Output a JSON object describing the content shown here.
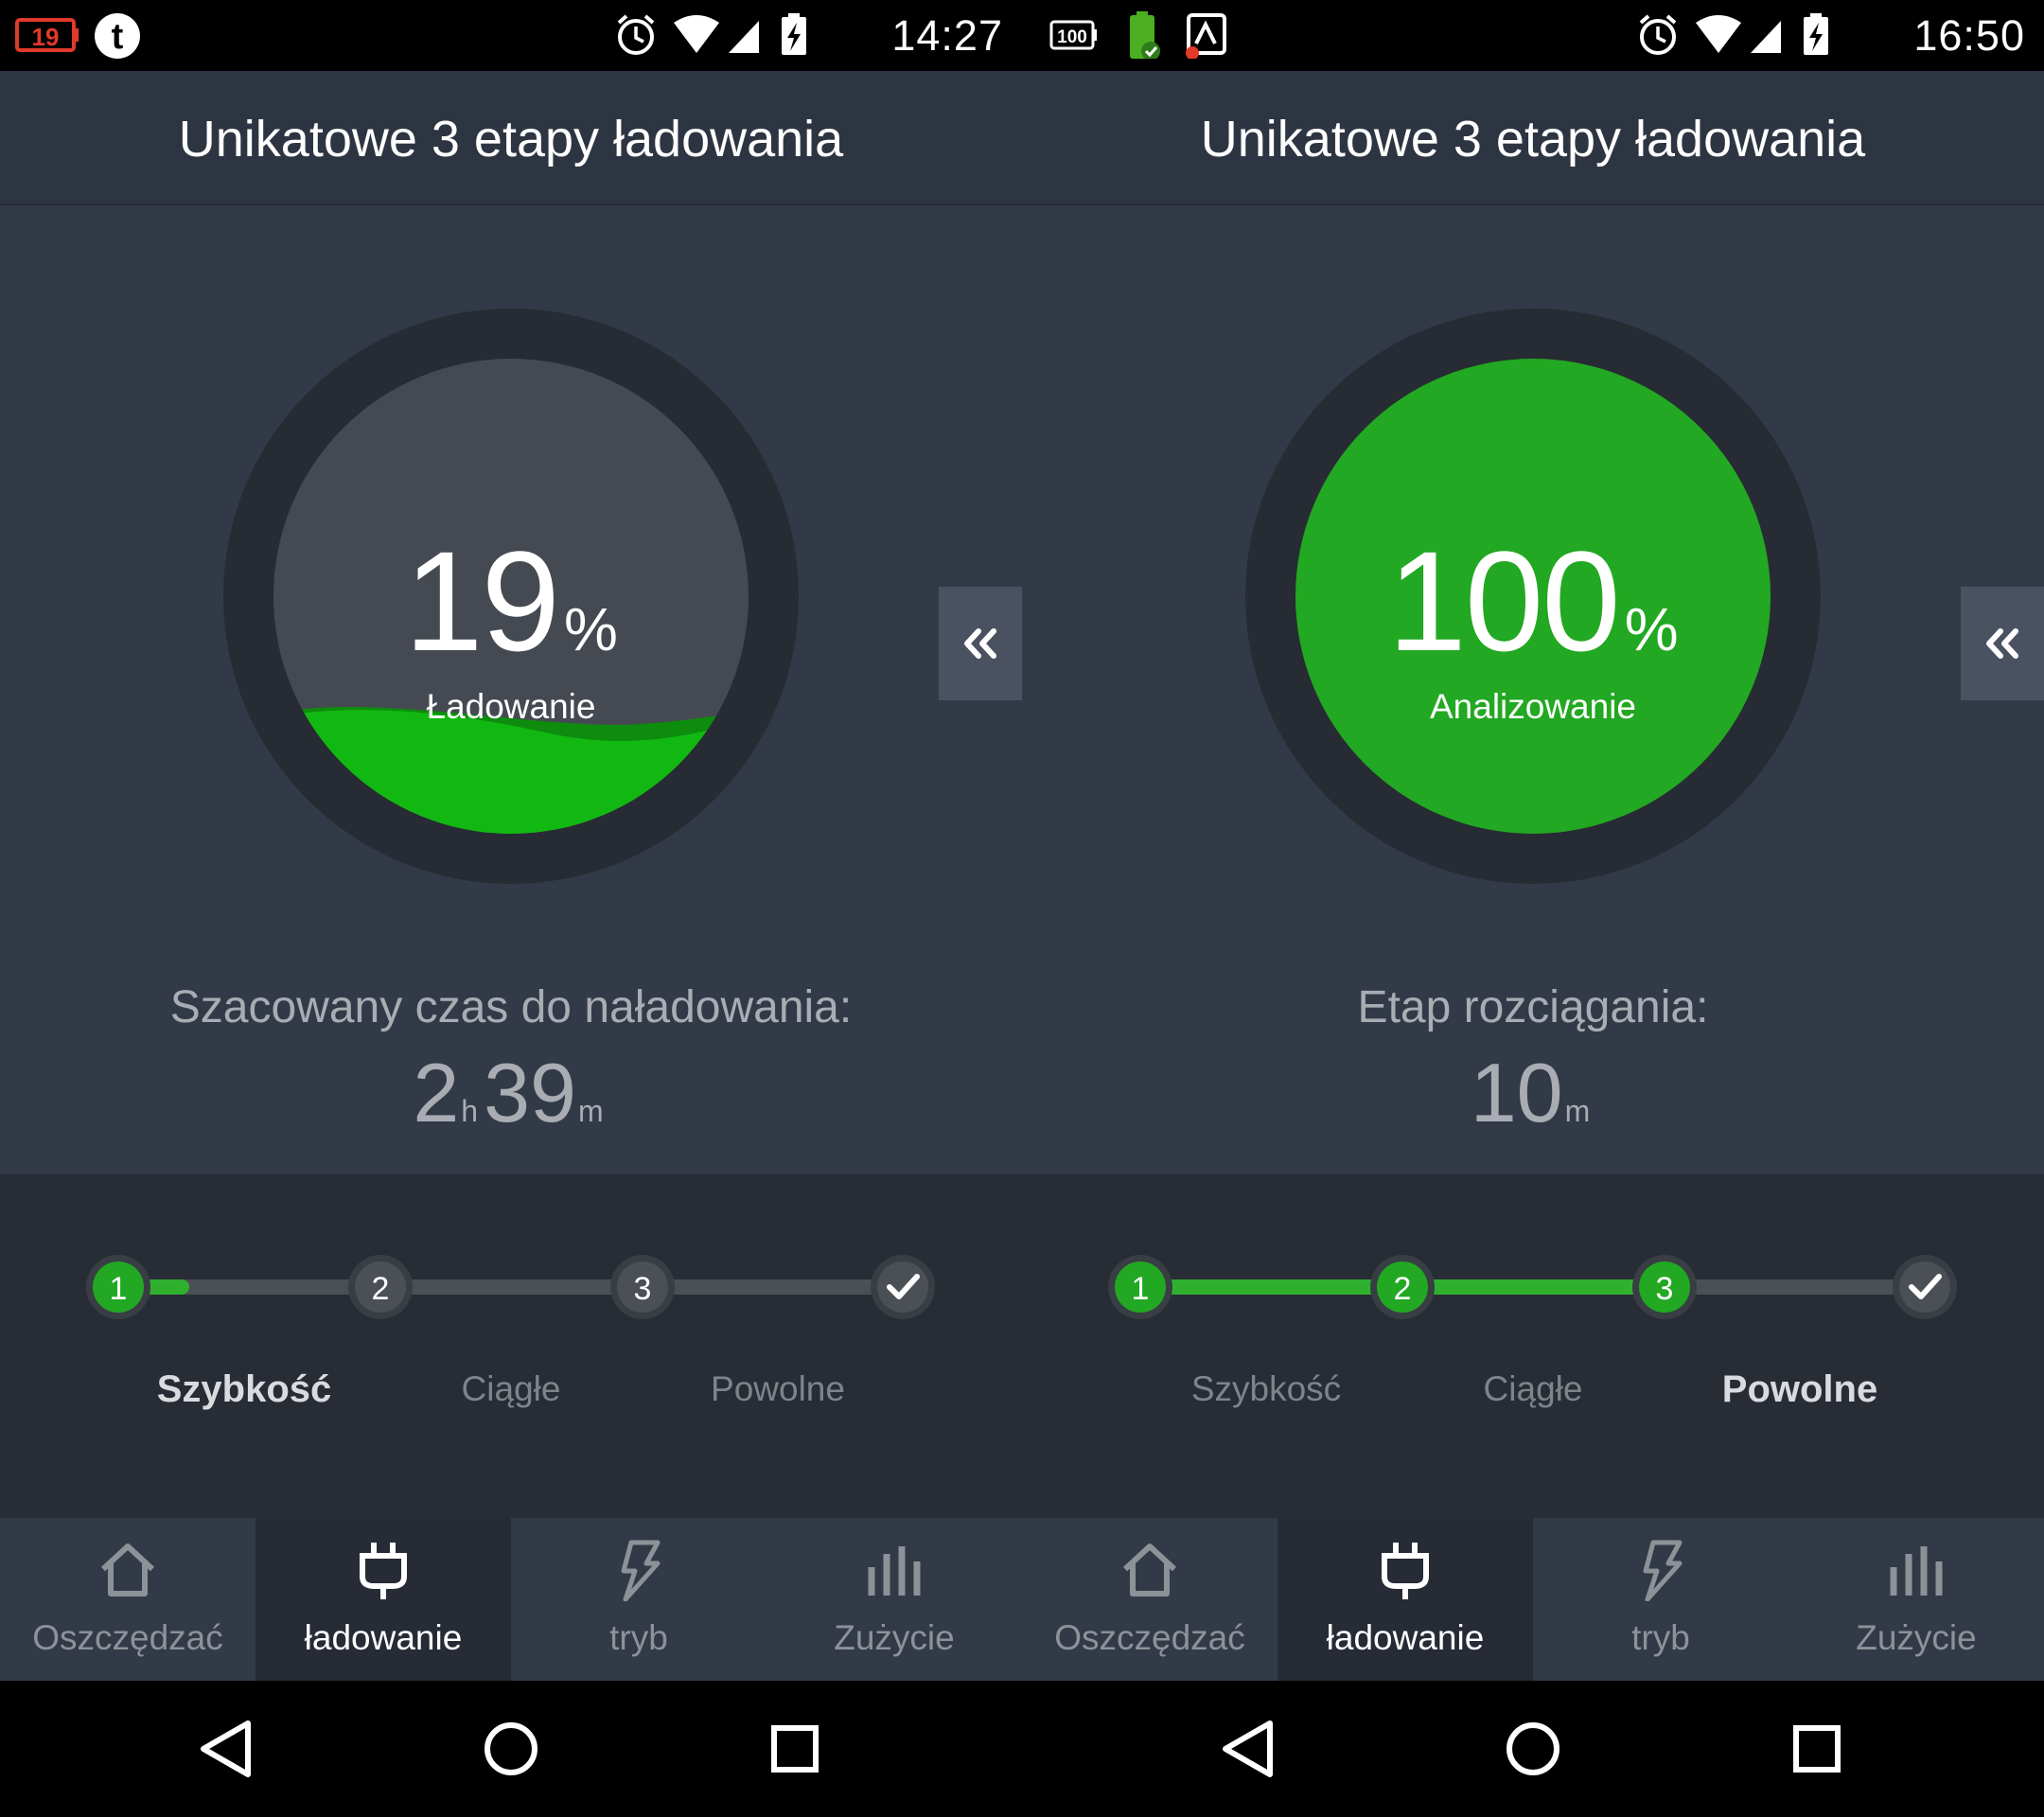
{
  "screens": [
    {
      "status": {
        "time": "14:27",
        "battery_badge": "19"
      },
      "header": {
        "title": "Unikatowe 3 etapy ładowania"
      },
      "gauge": {
        "percent": "19",
        "percent_symbol": "%",
        "state_label": "Ładowanie",
        "fill_fraction": 0.19
      },
      "estimate": {
        "label": "Szacowany czas do naładowania:",
        "hours": "2",
        "hours_unit": "h",
        "minutes": "39",
        "minutes_unit": "m"
      },
      "stages": {
        "nodes": [
          "1",
          "2",
          "3"
        ],
        "progress_fraction": 0.09,
        "labels": [
          "Szybkość",
          "Ciągłe",
          "Powolne"
        ],
        "active_index": 0
      },
      "nav": {
        "active": 1,
        "items": [
          "Oszczędzać",
          "ładowanie",
          "tryb",
          "Zużycie"
        ]
      }
    },
    {
      "status": {
        "time": "16:50",
        "battery_badge": "100"
      },
      "header": {
        "title": "Unikatowe 3 etapy ładowania"
      },
      "gauge": {
        "percent": "100",
        "percent_symbol": "%",
        "state_label": "Analizowanie",
        "fill_fraction": 1.0
      },
      "estimate": {
        "label": "Etap rozciągania:",
        "minutes": "10",
        "minutes_unit": "m"
      },
      "stages": {
        "nodes": [
          "1",
          "2",
          "3"
        ],
        "progress_fraction": 0.667,
        "labels": [
          "Szybkość",
          "Ciągłe",
          "Powolne"
        ],
        "active_index": 2
      },
      "nav": {
        "active": 1,
        "items": [
          "Oszczędzać",
          "ładowanie",
          "tryb",
          "Zużycie"
        ]
      }
    }
  ],
  "icons": {
    "expand": "double-chevron-left-icon",
    "nav": [
      "home-icon",
      "plug-icon",
      "lightning-icon",
      "bar-chart-icon"
    ],
    "android": [
      "back-icon",
      "home-circle-icon",
      "recents-icon"
    ]
  },
  "colors": {
    "accent_green": "#22a822",
    "wave_green": "#10b410",
    "panel": "#333a47",
    "header": "#2e3542",
    "stages_bg": "#282c35",
    "ring": "#272b33",
    "inner_circle": "#454a52"
  }
}
